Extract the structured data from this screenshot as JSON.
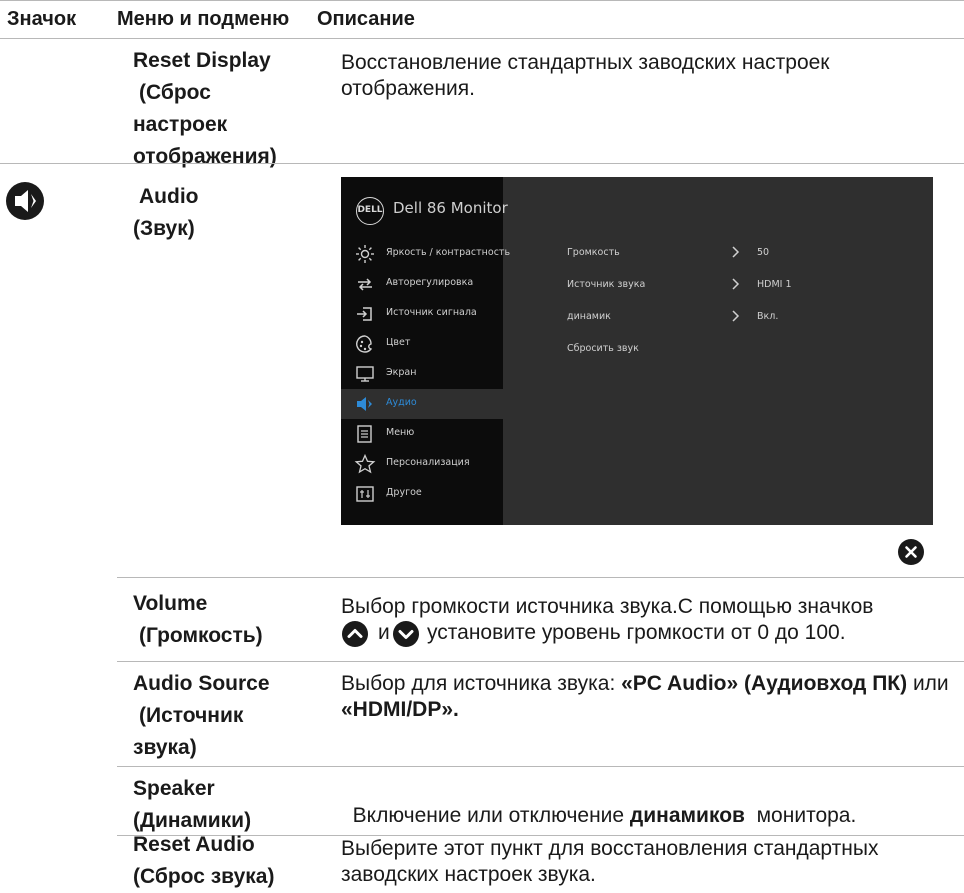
{
  "header": {
    "icon_col": "Значок",
    "menu_col": "Меню и подменю",
    "desc_col": "Описание"
  },
  "rows": {
    "reset_display": {
      "name_line1": "Reset Display",
      "name_line2": "(Сброс",
      "name_line3": "настроек",
      "name_line4": "отображения)",
      "desc": "Восстановление стандартных заводских настроек отображения."
    },
    "audio": {
      "name_line1": "Audio",
      "name_line2": "(Звук)"
    },
    "volume": {
      "name_line1": "Volume",
      "name_line2": "(Громкость)",
      "desc_line1": "Выбор громкости источника звука.С помощью значков",
      "desc_and": "и",
      "desc_line2_rest": "установите уровень громкости от 0 до 100."
    },
    "audio_source": {
      "name_line1": "Audio Source",
      "name_line2": "(Источник",
      "name_line3": "звука)",
      "desc_part1": "Выбор для источника звука: ",
      "desc_bold1": "«PC Audio» (Аудиовход ПК)",
      "desc_part2": " или ",
      "desc_bold2": "«HDMI/DP»."
    },
    "speaker": {
      "name_line1": "Speaker",
      "name_line2": "(Динамики)",
      "desc_part1": "Включение или отключение ",
      "desc_bold": "динамиков",
      "desc_part2": "  монитора."
    },
    "reset_audio": {
      "name_line1": "Reset Audio",
      "name_line2": "(Сброс звука)",
      "desc": "Выберите этот пункт для восстановления стандартных заводских настроек звука."
    }
  },
  "osd": {
    "logo": "DELL",
    "title": "Dell 86 Monitor",
    "nav": [
      {
        "label": "Яркость / контрастность",
        "icon": "brightness-icon"
      },
      {
        "label": "Авторегулировка",
        "icon": "auto-adjust-icon"
      },
      {
        "label": "Источник сигнала",
        "icon": "input-source-icon"
      },
      {
        "label": "Цвет",
        "icon": "color-icon"
      },
      {
        "label": "Экран",
        "icon": "display-icon"
      },
      {
        "label": "Аудио",
        "icon": "speaker-icon",
        "active": true
      },
      {
        "label": "Меню",
        "icon": "menu-icon"
      },
      {
        "label": "Персонализация",
        "icon": "star-icon"
      },
      {
        "label": "Другое",
        "icon": "other-icon"
      }
    ],
    "options": [
      {
        "label": "Громкость",
        "value": "50"
      },
      {
        "label": "Источник звука",
        "value": "HDMI 1"
      },
      {
        "label": "динамик",
        "value": "Вкл."
      },
      {
        "label": "Сбросить звук",
        "value": ""
      }
    ],
    "accent_color": "#2d8bd8"
  }
}
